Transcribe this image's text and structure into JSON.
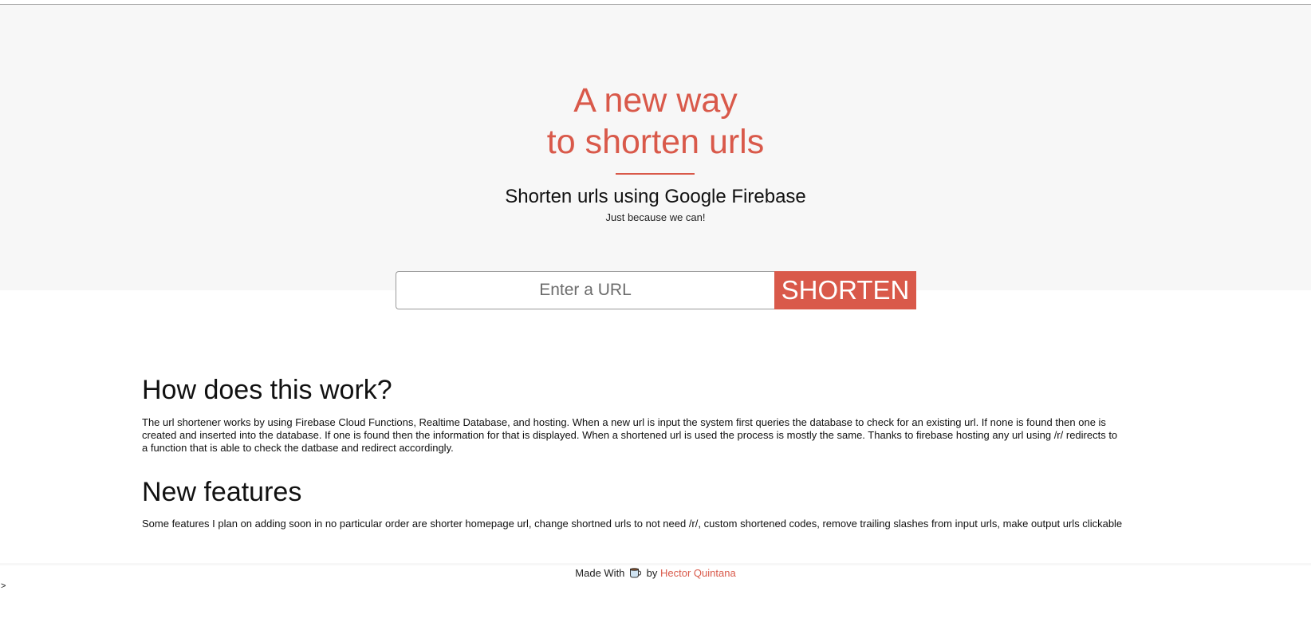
{
  "hero": {
    "title_line1": "A new way",
    "title_line2": "to shorten urls",
    "subtitle": "Shorten urls using Google Firebase",
    "tagline": "Just because we can!"
  },
  "form": {
    "placeholder": "Enter a URL",
    "value": "",
    "button_label": "SHORTEN"
  },
  "sections": [
    {
      "heading": "How does this work?",
      "body": "The url shortener works by using Firebase Cloud Functions, Realtime Database, and hosting. When a new url is input the system first queries the database to check for an existing url. If none is found then one is created and inserted into the database. If one is found then the information for that is displayed. When a shortened url is used the process is mostly the same. Thanks to firebase hosting any url using /r/ redirects to a function that is able to check the datbase and redirect accordingly."
    },
    {
      "heading": "New features",
      "body": "Some features I plan on adding soon in no particular order are shorter homepage url, change shortned urls to not need /r/, custom shortened codes, remove trailing slashes from input urls, make output urls clickable"
    }
  ],
  "footer": {
    "made_with": "Made With",
    "icon": "coffee-icon",
    "by": "by",
    "author": "Hector Quintana"
  },
  "stray_text": ">",
  "colors": {
    "accent": "#d9594a",
    "hero_background": "#f7f7f7",
    "text": "#111111"
  }
}
